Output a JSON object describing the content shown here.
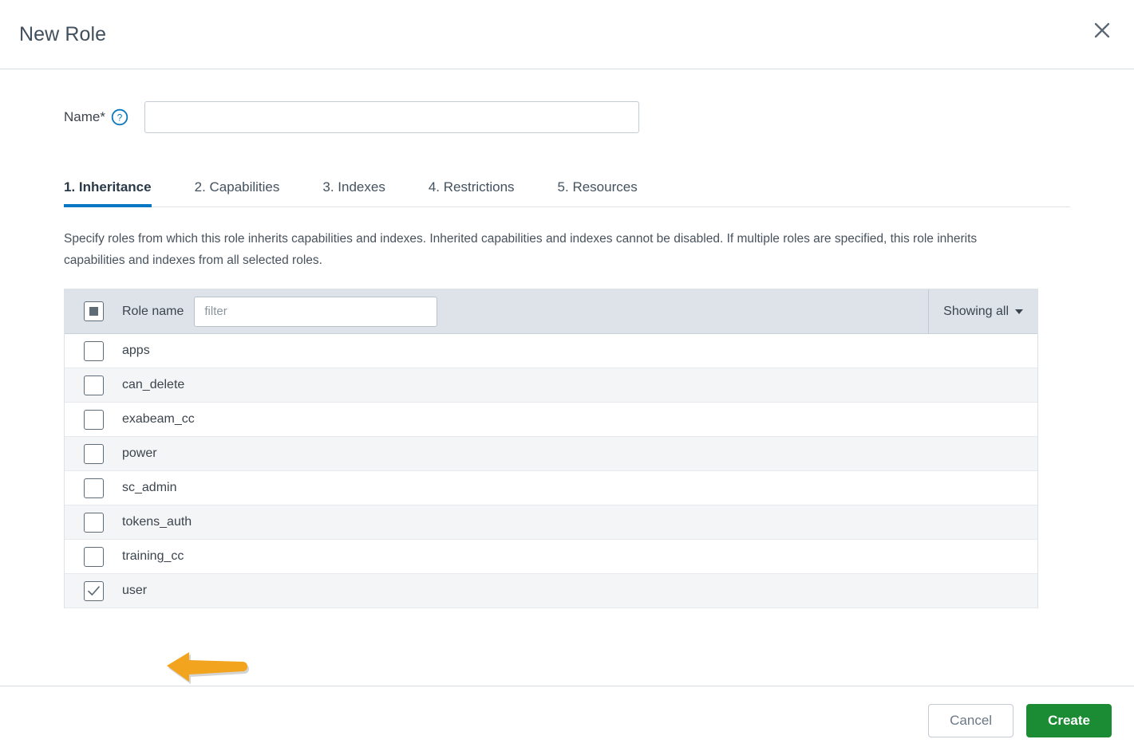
{
  "header": {
    "title": "New Role",
    "close_icon": "close-icon"
  },
  "form": {
    "name_label": "Name",
    "required_marker": "*",
    "help_icon": "help-circle-icon",
    "name_value": "",
    "name_placeholder": ""
  },
  "tabs": [
    {
      "label": "1. Inheritance",
      "active": true
    },
    {
      "label": "2. Capabilities",
      "active": false
    },
    {
      "label": "3. Indexes",
      "active": false
    },
    {
      "label": "4. Restrictions",
      "active": false
    },
    {
      "label": "5. Resources",
      "active": false
    }
  ],
  "inheritance": {
    "description": "Specify roles from which this role inherits capabilities and indexes. Inherited capabilities and indexes cannot be disabled. If multiple roles are specified, this role inherits capabilities and indexes from all selected roles.",
    "table": {
      "select_all_state": "indeterminate",
      "column_header": "Role name",
      "filter_placeholder": "filter",
      "filter_value": "",
      "showing_label": "Showing all",
      "showing_caret_icon": "chevron-down-icon",
      "rows": [
        {
          "name": "apps",
          "checked": false
        },
        {
          "name": "can_delete",
          "checked": false
        },
        {
          "name": "exabeam_cc",
          "checked": false
        },
        {
          "name": "power",
          "checked": false
        },
        {
          "name": "sc_admin",
          "checked": false
        },
        {
          "name": "tokens_auth",
          "checked": false
        },
        {
          "name": "training_cc",
          "checked": false
        },
        {
          "name": "user",
          "checked": true
        }
      ]
    }
  },
  "annotation": {
    "arrow_icon": "arrow-left-annotation",
    "color": "#f2a41f",
    "points_at": "user"
  },
  "footer": {
    "cancel_label": "Cancel",
    "create_label": "Create"
  },
  "colors": {
    "accent_blue": "#0877c4",
    "create_green": "#1c8c34",
    "table_header_bg": "#dde3e9",
    "row_alt_bg": "#f4f5f7",
    "annotation_orange": "#f2a41f"
  }
}
